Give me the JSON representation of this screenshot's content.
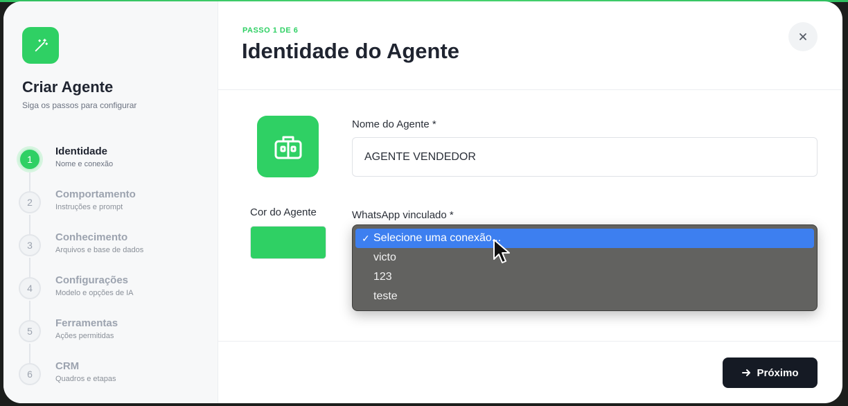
{
  "sidebar": {
    "icon": "magic-wand-icon",
    "title": "Criar Agente",
    "subtitle": "Siga os passos para configurar",
    "steps": [
      {
        "num": "1",
        "label": "Identidade",
        "desc": "Nome e conexão"
      },
      {
        "num": "2",
        "label": "Comportamento",
        "desc": "Instruções e prompt"
      },
      {
        "num": "3",
        "label": "Conhecimento",
        "desc": "Arquivos e base de dados"
      },
      {
        "num": "4",
        "label": "Configurações",
        "desc": "Modelo e opções de IA"
      },
      {
        "num": "5",
        "label": "Ferramentas",
        "desc": "Ações permitidas"
      },
      {
        "num": "6",
        "label": "CRM",
        "desc": "Quadros e etapas"
      }
    ]
  },
  "header": {
    "step_counter": "PASSO 1 DE 6",
    "title": "Identidade do Agente",
    "close_icon": "close-icon"
  },
  "form": {
    "avatar_icon": "robot-icon",
    "name_label": "Nome do Agente *",
    "name_value": "AGENTE VENDEDOR",
    "color_label": "Cor do Agente",
    "color_value": "#2fd064",
    "whatsapp_label": "WhatsApp vinculado *",
    "whatsapp_options": [
      "Selecione uma conexão...",
      "victo",
      "123",
      "teste"
    ],
    "whatsapp_selected_index": 0
  },
  "footer": {
    "next_label": "Próximo",
    "next_icon": "arrow-right-icon"
  },
  "colors": {
    "accent": "#2fd064",
    "dark_button": "#151a24",
    "selected_option": "#3d7ff0"
  }
}
